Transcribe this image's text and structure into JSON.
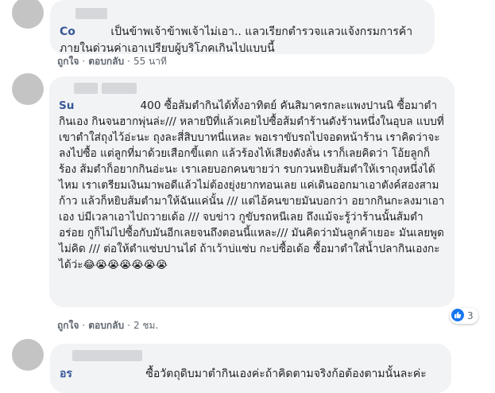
{
  "comments": [
    {
      "author_visible": "Co",
      "author_masked": "xxxxxxx",
      "text": "เป็นข้าพเจ้าข้าพเจ้าไม่เอา.. แลวเรียกตำรวจแลวแจ้งกรมการค้าภายในด่วนค่าเอาเปรียบผู้บริโภคเกินไปแบบนี้",
      "like_label": "ถูกใจ",
      "reply_label": "ตอบกลับ",
      "time": "55 นาที"
    },
    {
      "author_visible": "Su",
      "author_masked1": "xxxx",
      "author_masked2": "xxxxxx",
      "text": "400 ซื้อส้มตำกินได้ทั้งอาทิตย์ คันสิมาครกละแพงปานนิ ซื้อมาตำกินเอง กินจนฮากพุ่นล่ะ/// หลายปีที่แล้วเคยไปซื้อส้มตำร้านดังร้านหนึ่งในอุบล แบบที่เขาตำใส่ถุงไว้อ่ะนะ ถุงละสี่สิบบาทนี่แหละ พอเราขับรถไปจอดหน้าร้าน เราคิดว่าจะลงไปซื้อ แต่ลูกที่มาด้วยเสือกขี้แตก แล้วร้องไห้เสียงดังลั่น เราก็เลยคิดว่า โอ้ยลูกก็ร้อง ส้มตำก็อยากกินอ่ะนะ เราเลยบอกคนขายว่า รบกวนหยิบส้มตำให้เราถุงหนึ่งได้ไหม เราเตรียมเงินมาพอดีแล้วไม่ต้องยุ่งยากทอนเลย แค่เดินออกมาเอาตังค์สองสามก้าว แล้วก็หยิบส้มตำมาให้ฉันแค่นั้น /// แต่ไอ้คนขายมันบอกว่า อยากกินกะลงมาเอาเอง บ่มีเวลาเอาไปถวายเด้อ /// จบข่าว กูขับรถหนีเลย ถึงแม้จะรู้ว่าร้านนั้นส้มตำอร่อย กูก็ไม่ไปซื้อกับมันอีกเลยจนถึงตอนนี้แหละ/// มันคิดว่ามันลูกค้าเยอะ มันเลยพูดไม่คิด /// ต่อให้ตำแซ่บปานได๋ ถ้าเว้าบ่แซ่บ กะบ่ซื้อเด้อ ซื้อมาตำใส่น้ำปลากินเองกะได้ว่ะ",
      "emojis": "😂😭😭😭😭😭😭",
      "like_label": "ถูกใจ",
      "reply_label": "ตอบกลับ",
      "time": "2 ชม.",
      "reaction_count": "3"
    },
    {
      "author_visible": "อร",
      "author_masked": "xxxxxxxxxxxx",
      "text": "ซื้อวัตถุดิบมาตำกินเองค่ะถ้าคิดตามจริงก้อต้องตามนั้นละค่ะ"
    }
  ],
  "colors": {
    "author": "#385898",
    "bubble": "#f2f3f5",
    "meta": "#606770",
    "like": "#1877f2"
  }
}
